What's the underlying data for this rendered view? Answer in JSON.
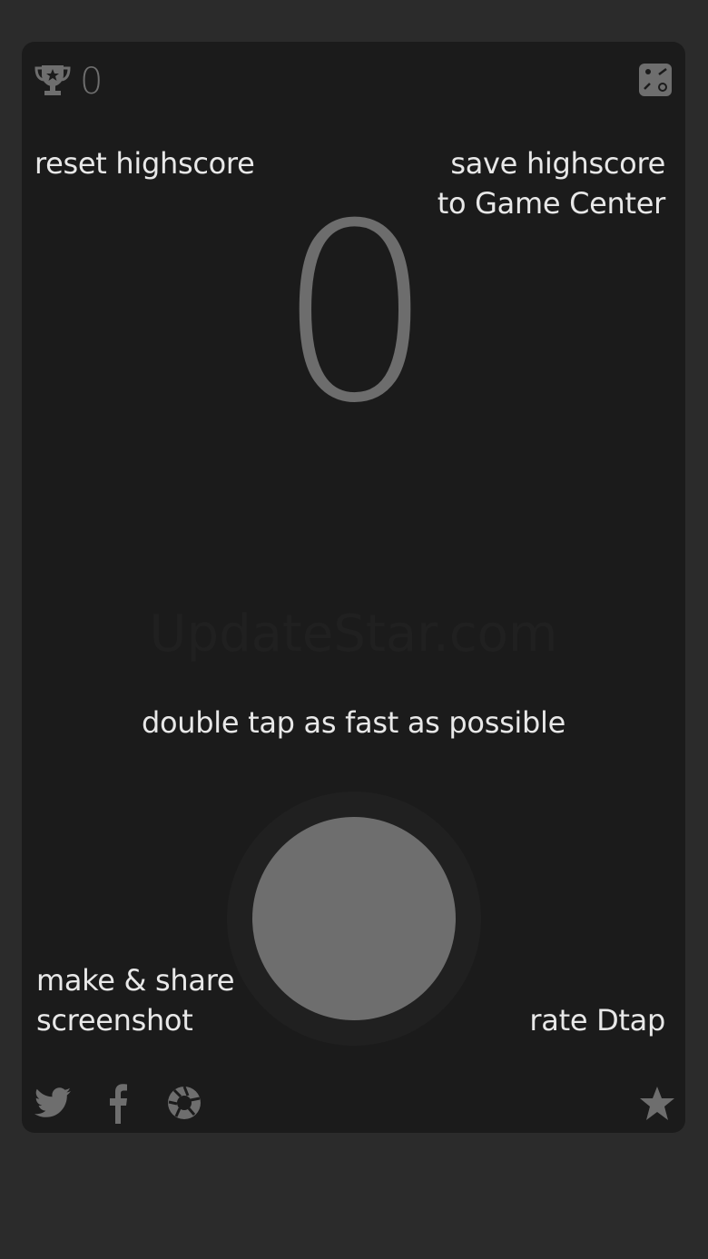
{
  "header": {
    "best_score": "0"
  },
  "actions": {
    "reset_highscore": "reset highscore",
    "save_highscore_line1": "save highscore",
    "save_highscore_line2": "to Game Center",
    "share_line1": "make & share",
    "share_line2": "screenshot",
    "rate": "rate Dtap"
  },
  "game": {
    "current_score": "0",
    "instruction": "double tap as fast as possible"
  },
  "watermark": "UpdateStar.com",
  "icons": {
    "best_score": "trophy-icon",
    "game_center": "game-center-icon",
    "twitter": "twitter-icon",
    "facebook": "facebook-icon",
    "screenshot_share": "aperture-icon",
    "rate": "star-icon"
  },
  "colors": {
    "background": "#2b2b2b",
    "card": "#1b1b1b",
    "score_gray": "#6d6d6d",
    "label_text": "#e8e8e8",
    "button_gray": "#6e6e6e"
  }
}
